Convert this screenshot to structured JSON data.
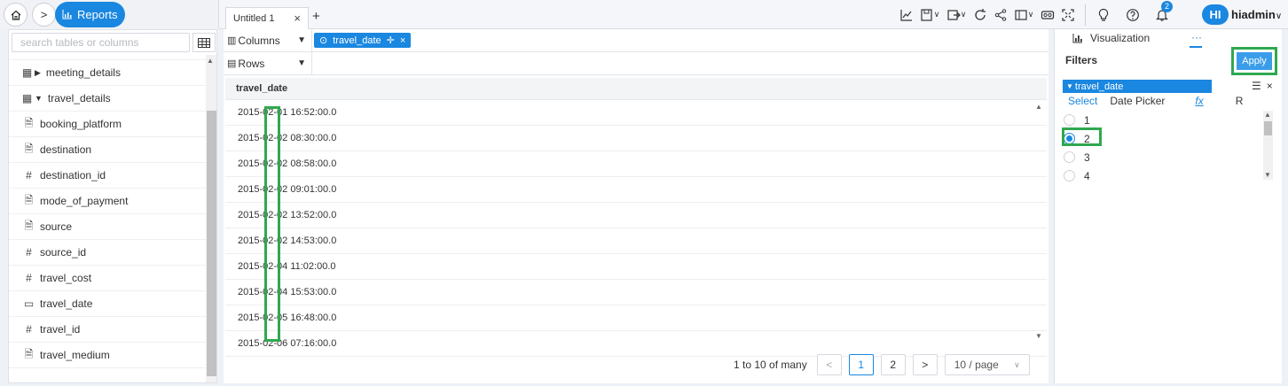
{
  "nav": {
    "reports_label": "Reports"
  },
  "tabs": [
    {
      "label": "Untitled 1"
    }
  ],
  "user": {
    "initials": "HI",
    "name": "hiadmin"
  },
  "notifications": {
    "count": "2"
  },
  "left_panel": {
    "search_placeholder": "search tables or columns",
    "tables": [
      {
        "label": "meeting_details",
        "expanded": false
      },
      {
        "label": "travel_details",
        "expanded": true
      }
    ],
    "fields": [
      {
        "label": "booking_platform",
        "icon": "text-icon"
      },
      {
        "label": "destination",
        "icon": "text-icon"
      },
      {
        "label": "destination_id",
        "icon": "hash-icon"
      },
      {
        "label": "mode_of_payment",
        "icon": "text-icon"
      },
      {
        "label": "source",
        "icon": "text-icon"
      },
      {
        "label": "source_id",
        "icon": "hash-icon"
      },
      {
        "label": "travel_cost",
        "icon": "hash-icon"
      },
      {
        "label": "travel_date",
        "icon": "calendar-icon"
      },
      {
        "label": "travel_id",
        "icon": "hash-icon"
      },
      {
        "label": "travel_medium",
        "icon": "text-icon"
      }
    ]
  },
  "shelves": {
    "columns_label": "Columns",
    "rows_label": "Rows",
    "column_chip": "travel_date"
  },
  "table": {
    "header": "travel_date",
    "rows": [
      "2015-02-01 16:52:00.0",
      "2015-02-02 08:30:00.0",
      "2015-02-02 08:58:00.0",
      "2015-02-02 09:01:00.0",
      "2015-02-02 13:52:00.0",
      "2015-02-02 14:53:00.0",
      "2015-02-04 11:02:00.0",
      "2015-02-04 15:53:00.0",
      "2015-02-05 16:48:00.0",
      "2015-02-06 07:16:00.0"
    ]
  },
  "pagination": {
    "total_text": "1 to 10 of many",
    "pages": [
      "1",
      "2"
    ],
    "current_page": "1",
    "page_size": "10 / page"
  },
  "right_panel": {
    "viz_label": "Visualization",
    "more_label": "···",
    "filters_title": "Filters",
    "apply_label": "Apply",
    "filter_name": "travel_date",
    "filter_tabs": [
      "Select",
      "Date Picker",
      "fx",
      "R"
    ],
    "options": [
      {
        "label": "1",
        "selected": false
      },
      {
        "label": "2",
        "selected": true
      },
      {
        "label": "3",
        "selected": false
      },
      {
        "label": "4",
        "selected": false
      }
    ]
  },
  "colors": {
    "accent": "#1a87e0",
    "highlight": "#2fa84f"
  }
}
